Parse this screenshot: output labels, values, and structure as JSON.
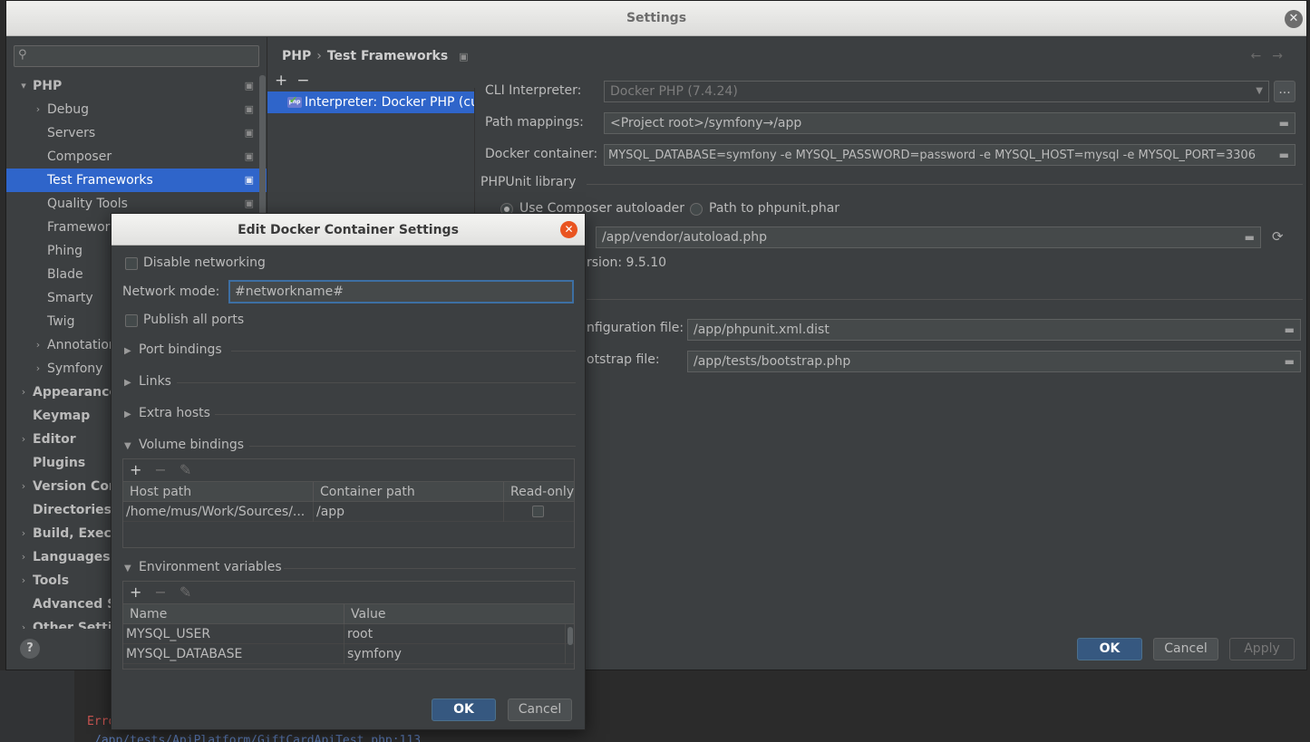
{
  "background": {
    "error_text": "Erro",
    "link_text": "/app/tests/ApiPlatform/GiftCardApiTest.php:113"
  },
  "window": {
    "title": "Settings",
    "close": "✕"
  },
  "tree": {
    "items": [
      {
        "label": "PHP",
        "arrow": "▾",
        "proj": true,
        "bold": true,
        "indent": 0
      },
      {
        "label": "Debug",
        "arrow": "›",
        "proj": true,
        "bold": false,
        "indent": 1
      },
      {
        "label": "Servers",
        "arrow": "",
        "proj": true,
        "bold": false,
        "indent": 1
      },
      {
        "label": "Composer",
        "arrow": "",
        "proj": true,
        "bold": false,
        "indent": 1
      },
      {
        "label": "Test Frameworks",
        "arrow": "",
        "proj": true,
        "bold": false,
        "indent": 1,
        "selected": true
      },
      {
        "label": "Quality Tools",
        "arrow": "",
        "proj": true,
        "bold": false,
        "indent": 1
      },
      {
        "label": "Framework",
        "arrow": "",
        "proj": false,
        "bold": false,
        "indent": 1
      },
      {
        "label": "Phing",
        "arrow": "",
        "proj": false,
        "bold": false,
        "indent": 1
      },
      {
        "label": "Blade",
        "arrow": "",
        "proj": false,
        "bold": false,
        "indent": 1
      },
      {
        "label": "Smarty",
        "arrow": "",
        "proj": false,
        "bold": false,
        "indent": 1
      },
      {
        "label": "Twig",
        "arrow": "",
        "proj": false,
        "bold": false,
        "indent": 1
      },
      {
        "label": "Annotation",
        "arrow": "›",
        "proj": false,
        "bold": false,
        "indent": 1
      },
      {
        "label": "Symfony",
        "arrow": "›",
        "proj": false,
        "bold": false,
        "indent": 1
      },
      {
        "label": "Appearance",
        "arrow": "›",
        "proj": false,
        "bold": true,
        "indent": 0
      },
      {
        "label": "Keymap",
        "arrow": "",
        "proj": false,
        "bold": true,
        "indent": 0
      },
      {
        "label": "Editor",
        "arrow": "›",
        "proj": false,
        "bold": true,
        "indent": 0
      },
      {
        "label": "Plugins",
        "arrow": "",
        "proj": false,
        "bold": true,
        "indent": 0
      },
      {
        "label": "Version Con",
        "arrow": "›",
        "proj": false,
        "bold": true,
        "indent": 0
      },
      {
        "label": "Directories",
        "arrow": "",
        "proj": false,
        "bold": true,
        "indent": 0
      },
      {
        "label": "Build, Execu",
        "arrow": "›",
        "proj": false,
        "bold": true,
        "indent": 0
      },
      {
        "label": "Languages &",
        "arrow": "›",
        "proj": false,
        "bold": true,
        "indent": 0
      },
      {
        "label": "Tools",
        "arrow": "›",
        "proj": false,
        "bold": true,
        "indent": 0
      },
      {
        "label": "Advanced Se",
        "arrow": "",
        "proj": false,
        "bold": true,
        "indent": 0
      },
      {
        "label": "Other Setti",
        "arrow": "›",
        "proj": false,
        "bold": true,
        "indent": 0
      }
    ]
  },
  "breadcrumb": {
    "part1": "PHP",
    "sep": "›",
    "part2": "Test Frameworks"
  },
  "list_tools": {
    "add": "+",
    "remove": "−"
  },
  "interpreter_item": "Interpreter: Docker PHP (current project interpreter)",
  "form": {
    "cli_label": "CLI Interpreter:",
    "cli_value": "Docker PHP (7.4.24)",
    "path_label": "Path mappings:",
    "path_value": "<Project root>/symfony→/app",
    "docker_label": "Docker container:",
    "docker_value": "MYSQL_DATABASE=symfony -e MYSQL_PASSWORD=password -e MYSQL_HOST=mysql -e MYSQL_PORT=3306",
    "phpunit_title": "PHPUnit library",
    "radio1": "Use Composer autoloader",
    "radio2": "Path to phpunit.phar",
    "autoload_value": "/app/vendor/autoload.php",
    "version_text": "rsion: 9.5.10",
    "config_label": "nfiguration file:",
    "config_value": "/app/phpunit.xml.dist",
    "bootstrap_label": "otstrap file:",
    "bootstrap_value": "/app/tests/bootstrap.php",
    "dots": "...",
    "folder_icon": "▬"
  },
  "buttons": {
    "ok": "OK",
    "cancel": "Cancel",
    "apply": "Apply",
    "help": "?"
  },
  "dialog": {
    "title": "Edit Docker Container Settings",
    "close": "✕",
    "disable_networking": "Disable networking",
    "network_mode_label": "Network mode:",
    "network_mode_value": "#networkname#",
    "publish_all_ports": "Publish all ports",
    "port_bindings": "Port bindings",
    "links": "Links",
    "extra_hosts": "Extra hosts",
    "volume_bindings": "Volume bindings",
    "volume_table": {
      "headers": [
        "Host path",
        "Container path",
        "Read-only"
      ],
      "rows": [
        [
          "/home/mus/Work/Sources/...",
          "/app"
        ]
      ]
    },
    "env_vars": "Environment variables",
    "env_table": {
      "headers": [
        "Name",
        "Value"
      ],
      "rows": [
        [
          "MYSQL_USER",
          "root"
        ],
        [
          "MYSQL_DATABASE",
          "symfony"
        ]
      ]
    },
    "ok": "OK",
    "cancel": "Cancel"
  }
}
